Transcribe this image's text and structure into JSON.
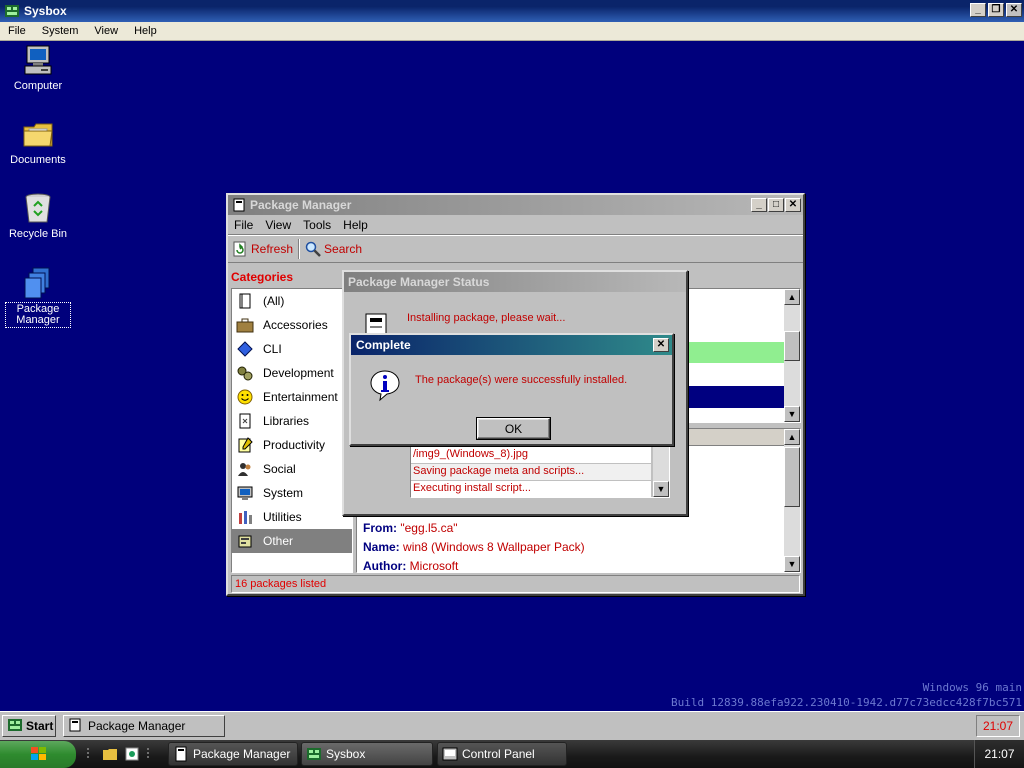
{
  "host_window": {
    "title": "Sysbox",
    "menu": [
      "File",
      "System",
      "View",
      "Help"
    ]
  },
  "desktop": {
    "icons": [
      {
        "label": "Computer"
      },
      {
        "label": "Documents"
      },
      {
        "label": "Recycle Bin"
      },
      {
        "label": "Package Manager"
      }
    ],
    "watermark": {
      "line1": "Windows 96 main",
      "line2": "Build 12839.88efa922.230410-1942.d77c73edcc428f7bc571"
    }
  },
  "package_manager": {
    "title": "Package Manager",
    "menu": [
      "File",
      "View",
      "Tools",
      "Help"
    ],
    "toolbar": {
      "refresh": "Refresh",
      "search": "Search"
    },
    "categories_heading": "Categories",
    "categories": [
      "(All)",
      "Accessories",
      "CLI",
      "Development",
      "Entertainment",
      "Libraries",
      "Productivity",
      "Social",
      "System",
      "Utilities",
      "Other"
    ],
    "selected_category": "Other",
    "details": {
      "from_label": "From:",
      "from_value": "\"egg.l5.ca\"",
      "name_label": "Name:",
      "name_value": "win8 (Windows 8 Wallpaper Pack)",
      "author_label": "Author:",
      "author_value": "Microsoft"
    },
    "status": "16 packages listed",
    "colors": {
      "green_row": "#90ee90",
      "selected_row": "#000080"
    }
  },
  "status_dialog": {
    "title": "Package Manager Status",
    "message": "Installing package, please wait...",
    "log": [
      "/img9_(Windows_8).jpg",
      "Saving package meta and scripts...",
      "Executing install script..."
    ]
  },
  "complete_dialog": {
    "title": "Complete",
    "close": "✕",
    "message": "The package(s) were successfully installed.",
    "ok": "OK"
  },
  "taskbar_w96": {
    "start": "Start",
    "task": "Package Manager",
    "clock": "21:07"
  },
  "taskbar_xp": {
    "tasks": [
      "Package Manager",
      "Sysbox",
      "Control Panel"
    ],
    "clock": "21:07"
  }
}
